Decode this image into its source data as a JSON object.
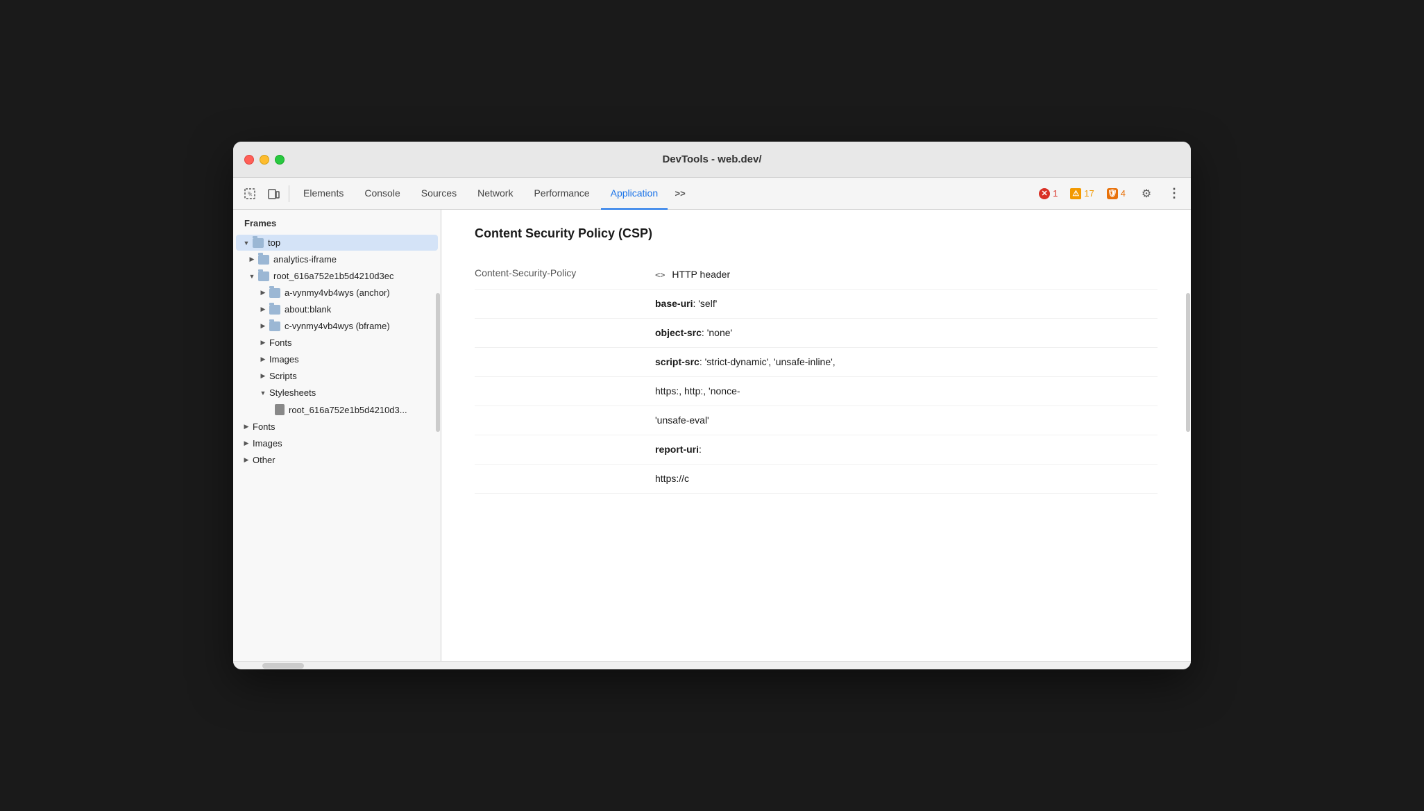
{
  "window": {
    "title": "DevTools - web.dev/"
  },
  "toolbar": {
    "tabs": [
      {
        "id": "elements",
        "label": "Elements",
        "active": false
      },
      {
        "id": "console",
        "label": "Console",
        "active": false
      },
      {
        "id": "sources",
        "label": "Sources",
        "active": false
      },
      {
        "id": "network",
        "label": "Network",
        "active": false
      },
      {
        "id": "performance",
        "label": "Performance",
        "active": false
      },
      {
        "id": "application",
        "label": "Application",
        "active": true
      }
    ],
    "more_label": ">>",
    "error_count": "1",
    "warning_count": "17",
    "info_count": "4"
  },
  "sidebar": {
    "section_title": "Frames",
    "items": [
      {
        "id": "top",
        "label": "top",
        "indent": 0,
        "type": "folder",
        "expanded": true,
        "selected": true
      },
      {
        "id": "analytics-iframe",
        "label": "analytics-iframe",
        "indent": 1,
        "type": "folder",
        "expanded": false
      },
      {
        "id": "root_616a",
        "label": "root_616a752e1b5d4210d3ec",
        "indent": 1,
        "type": "folder",
        "expanded": true
      },
      {
        "id": "a-vynmy",
        "label": "a-vynmy4vb4wys (anchor)",
        "indent": 2,
        "type": "folder",
        "expanded": false
      },
      {
        "id": "about-blank",
        "label": "about:blank",
        "indent": 2,
        "type": "folder",
        "expanded": false
      },
      {
        "id": "c-vynmy",
        "label": "c-vynmy4vb4wys (bframe)",
        "indent": 2,
        "type": "folder",
        "expanded": false
      },
      {
        "id": "fonts-sub",
        "label": "Fonts",
        "indent": 2,
        "type": "group",
        "expanded": false
      },
      {
        "id": "images-sub",
        "label": "Images",
        "indent": 2,
        "type": "group",
        "expanded": false
      },
      {
        "id": "scripts-sub",
        "label": "Scripts",
        "indent": 2,
        "type": "group",
        "expanded": false
      },
      {
        "id": "stylesheets-sub",
        "label": "Stylesheets",
        "indent": 2,
        "type": "group",
        "expanded": true
      },
      {
        "id": "stylesheet-file",
        "label": "root_616a752e1b5d4210d3...",
        "indent": 3,
        "type": "file"
      },
      {
        "id": "fonts",
        "label": "Fonts",
        "indent": 0,
        "type": "group",
        "expanded": false
      },
      {
        "id": "images",
        "label": "Images",
        "indent": 0,
        "type": "group",
        "expanded": false
      },
      {
        "id": "other",
        "label": "Other",
        "indent": 0,
        "type": "group",
        "expanded": false
      }
    ]
  },
  "content": {
    "title": "Content Security Policy (CSP)",
    "header_key": "Content-Security-Policy",
    "header_type_icon": "<>",
    "header_type_label": "HTTP header",
    "policies": [
      {
        "name": "base-uri",
        "value": ": 'self'"
      },
      {
        "name": "object-src",
        "value": ": 'none'"
      },
      {
        "name": "script-src",
        "value": ": 'strict-dynamic', 'unsafe-inline',"
      },
      {
        "name": "",
        "value": "https:, http:, 'nonce-"
      },
      {
        "name": "",
        "value": "'unsafe-eval'"
      },
      {
        "name": "report-uri",
        "value": ":"
      },
      {
        "name": "",
        "value": "https://c"
      }
    ]
  },
  "icons": {
    "inspect": "⊡",
    "device": "⬚",
    "more": "⋮",
    "settings": "⚙"
  }
}
